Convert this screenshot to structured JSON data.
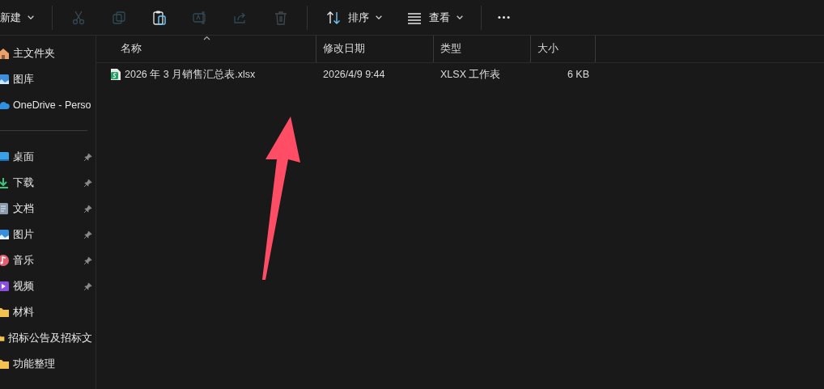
{
  "toolbar": {
    "items": [
      {
        "kind": "new",
        "label": "新建",
        "dropdown": true,
        "disabled": false
      },
      {
        "kind": "cut",
        "disabled": true
      },
      {
        "kind": "copy",
        "disabled": true
      },
      {
        "kind": "paste",
        "disabled": false
      },
      {
        "kind": "rename",
        "disabled": true
      },
      {
        "kind": "share",
        "disabled": true
      },
      {
        "kind": "delete",
        "disabled": true
      },
      {
        "kind": "sort",
        "label": "排序",
        "dropdown": true,
        "disabled": false
      },
      {
        "kind": "view",
        "label": "查看",
        "dropdown": true,
        "disabled": false
      },
      {
        "kind": "more",
        "disabled": false
      }
    ]
  },
  "sidebar": {
    "groups": [
      [
        {
          "kind": "home",
          "label": "主文件夹",
          "pinned": false
        },
        {
          "kind": "gallery",
          "label": "图库",
          "pinned": false
        },
        {
          "kind": "cloud",
          "label": "OneDrive - Perso",
          "pinned": false
        }
      ],
      [
        {
          "kind": "desktop",
          "label": "桌面",
          "pinned": true
        },
        {
          "kind": "download",
          "label": "下载",
          "pinned": true
        },
        {
          "kind": "document",
          "label": "文档",
          "pinned": true
        },
        {
          "kind": "pictures",
          "label": "图片",
          "pinned": true
        },
        {
          "kind": "music",
          "label": "音乐",
          "pinned": true
        },
        {
          "kind": "video",
          "label": "视频",
          "pinned": true
        },
        {
          "kind": "folder",
          "label": "材料",
          "pinned": false
        },
        {
          "kind": "folder",
          "label": "招标公告及招标文",
          "pinned": false
        },
        {
          "kind": "folder",
          "label": "功能整理",
          "pinned": false
        }
      ]
    ]
  },
  "table": {
    "columns": [
      {
        "label": "名称",
        "sorted": true
      },
      {
        "label": "修改日期",
        "sorted": false
      },
      {
        "label": "类型",
        "sorted": false
      },
      {
        "label": "大小",
        "sorted": false
      }
    ],
    "rows": [
      {
        "name": "2026 年 3 月销售汇总表.xlsx",
        "date": "2026/4/9 9:44",
        "type": "XLSX 工作表",
        "size": "6 KB",
        "selected": false
      }
    ]
  },
  "annotation": {
    "kind": "arrow"
  }
}
